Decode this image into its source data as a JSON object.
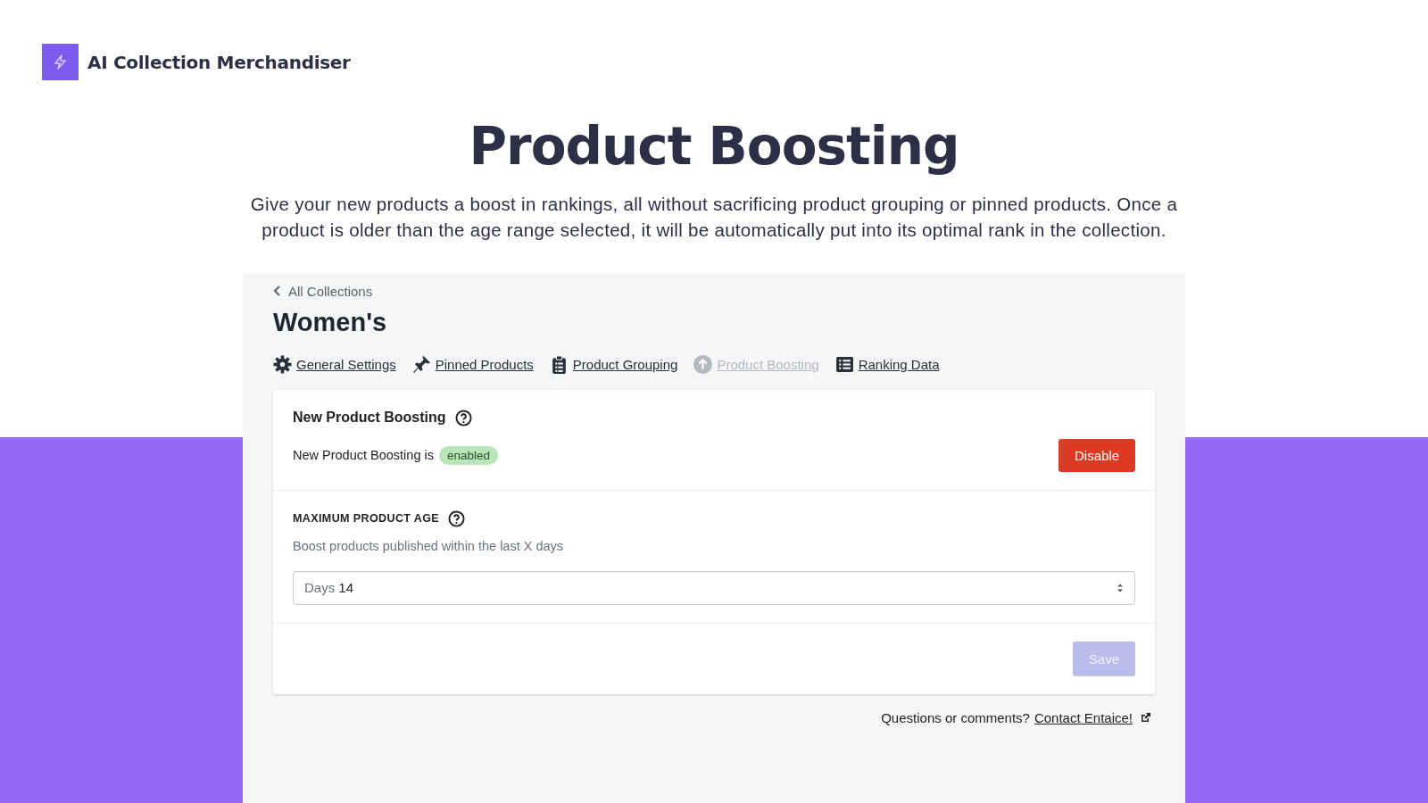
{
  "brand": {
    "name": "AI Collection Merchandiser"
  },
  "hero": {
    "title": "Product Boosting",
    "description": "Give your new products a boost in rankings, all without sacrificing product grouping or pinned products. Once a product is older than the age range selected, it will be automatically put into its optimal rank in the collection."
  },
  "app": {
    "back_link": "All Collections",
    "page_title": "Women's",
    "tabs": [
      {
        "label": "General Settings",
        "kind": "gear",
        "selected": false
      },
      {
        "label": "Pinned Products",
        "kind": "pin",
        "selected": false
      },
      {
        "label": "Product Grouping",
        "kind": "clipboard",
        "selected": false
      },
      {
        "label": "Product Boosting",
        "kind": "arrow",
        "selected": true
      },
      {
        "label": "Ranking Data",
        "kind": "list",
        "selected": false
      }
    ],
    "card": {
      "title": "New Product Boosting",
      "status_text": "New Product Boosting is",
      "status_badge": "enabled",
      "toggle_button": "Disable",
      "age_label": "MAXIMUM PRODUCT AGE",
      "age_hint": "Boost products published within the last X days",
      "select_prefix": "Days",
      "select_value": "14",
      "save_button": {
        "label": "Save",
        "disabled": true
      }
    },
    "footer": {
      "text": "Questions or comments?",
      "link": "Contact Entaice!"
    }
  }
}
